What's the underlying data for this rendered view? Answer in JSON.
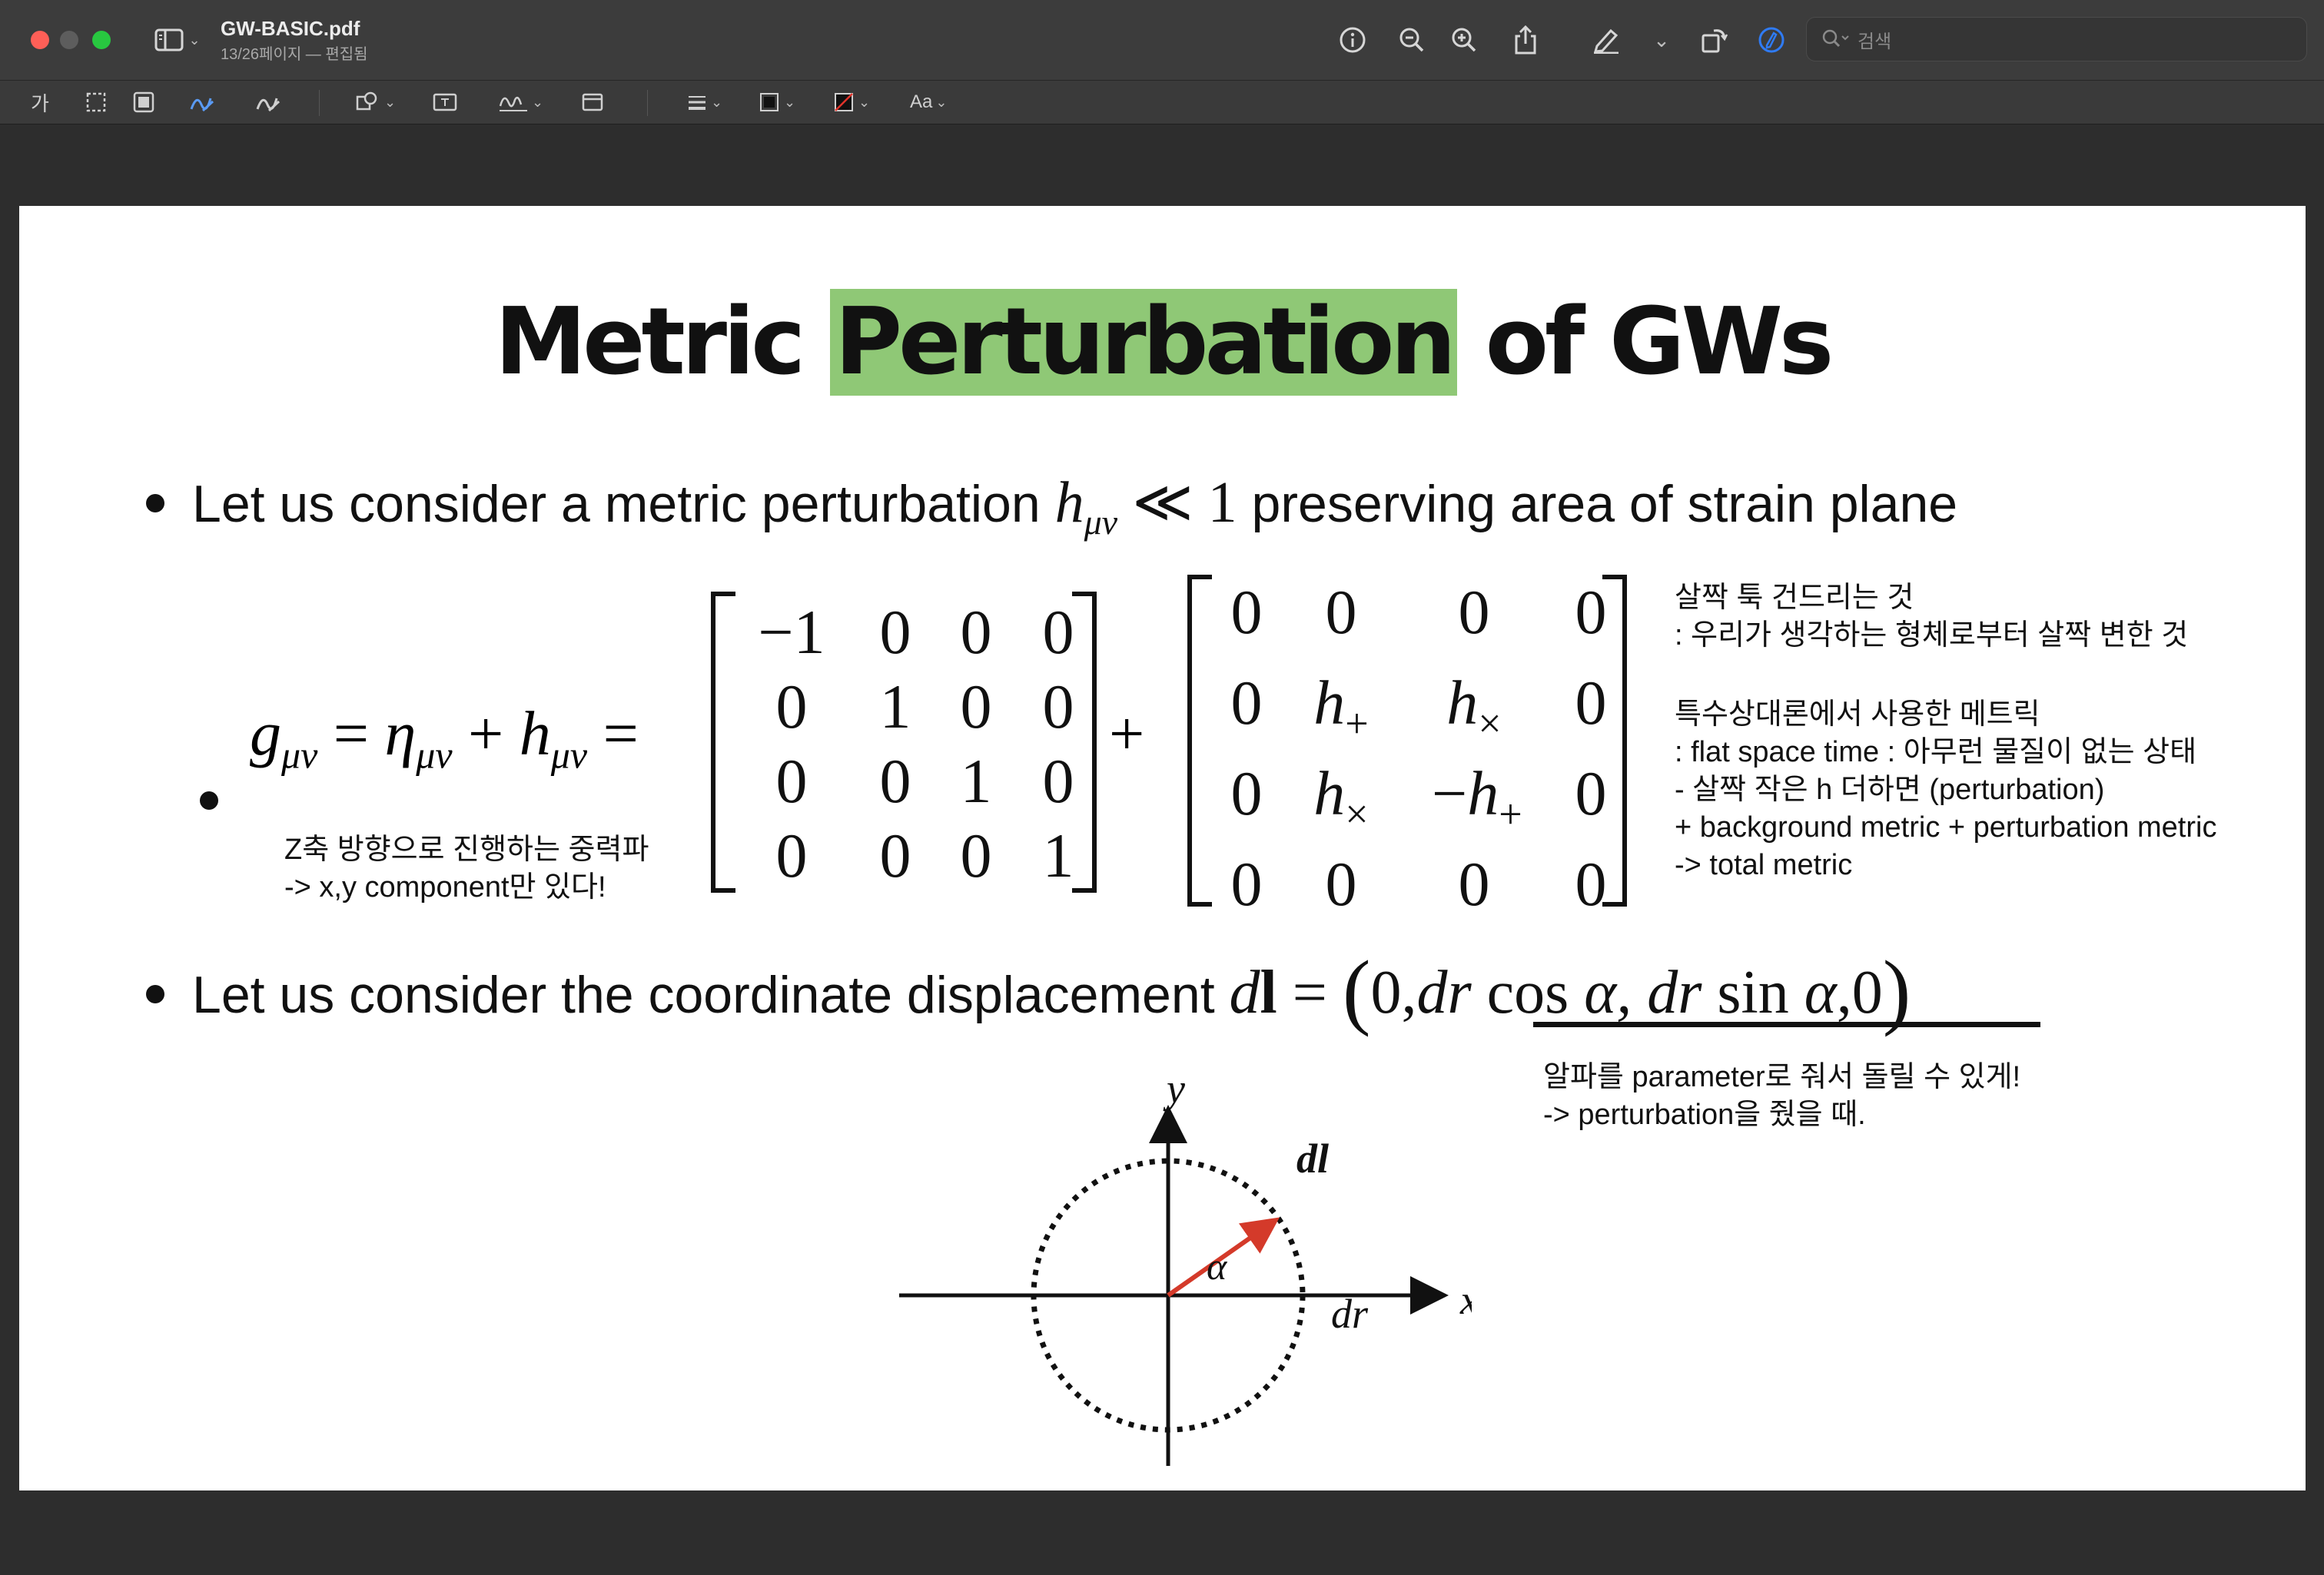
{
  "window": {
    "file_name": "GW-BASIC.pdf",
    "subtitle": "13/26페이지 — 편집됨"
  },
  "toolbar": {
    "search_placeholder": "검색",
    "text_size_label": "Aa",
    "text_tool_label": "가"
  },
  "colors": {
    "title_highlight": "#8fc876",
    "arrow": "#d43a2a",
    "accent_blue": "#2f7bf5"
  },
  "slide": {
    "title_part1": "Metric ",
    "title_highlight": "Perturbation",
    "title_part2": " of GWs",
    "bullet1_text": "Let us consider a metric perturbation ",
    "bullet1_tail": " preserving area of strain plane",
    "bullet3_text": "Let us consider the coordinate displacement ",
    "note_z_1": "Z축 방향으로 진행하는 중력파",
    "note_z_2": "-> x,y component만 있다!",
    "note_r1_1": "살짝 툭 건드리는 것",
    "note_r1_2": ": 우리가 생각하는 형체로부터 살짝 변한 것",
    "note_r2_1": "특수상대론에서 사용한 메트릭",
    "note_r2_2": ": flat space time : 아무런 물질이 없는 상태",
    "note_r2_3": "- 살짝 작은 h 더하면 (perturbation)",
    "note_r2_4": "+ background metric + perturbation metric",
    "note_r2_5": "-> total metric",
    "note_alpha_1": "알파를 parameter로 줘서 돌릴 수 있게!",
    "note_alpha_2": "-> perturbation을 줬을 때.",
    "eta_matrix": [
      [
        "−1",
        "0",
        "0",
        "0"
      ],
      [
        "0",
        "1",
        "0",
        "0"
      ],
      [
        "0",
        "0",
        "1",
        "0"
      ],
      [
        "0",
        "0",
        "0",
        "1"
      ]
    ],
    "h_matrix": [
      [
        "0",
        "0",
        "0",
        "0"
      ],
      [
        "0",
        "h+",
        "h×",
        "0"
      ],
      [
        "0",
        "h×",
        "−h+",
        "0"
      ],
      [
        "0",
        "0",
        "0",
        "0"
      ]
    ],
    "diagram": {
      "x_label": "x",
      "y_label": "y",
      "alpha_label": "α",
      "dr_label": "dr",
      "dl_label": "dl",
      "alpha_deg": 35
    }
  }
}
